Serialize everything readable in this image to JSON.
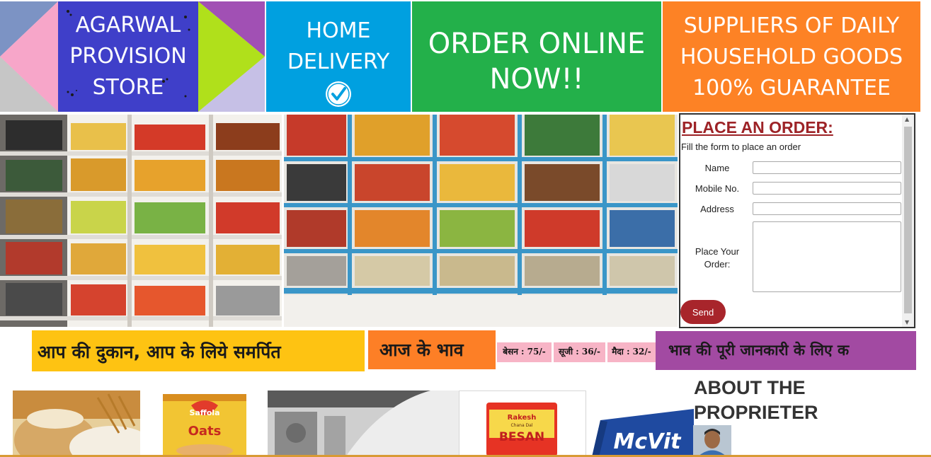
{
  "header": {
    "logo_lines": [
      "AGARWAL",
      "PROVISION",
      "STORE"
    ],
    "delivery_lines": [
      "HOME",
      "DELIVERY"
    ],
    "order_online_lines": [
      "ORDER ONLINE",
      "NOW!!"
    ],
    "supplier_lines": [
      "SUPPLIERS OF DAILY",
      "HOUSEHOLD GOODS",
      "100% GUARANTEE"
    ]
  },
  "order_form": {
    "title": "PLACE AN ORDER:",
    "subtitle": "Fill the form to place an order",
    "name_label": "Name",
    "mobile_label": "Mobile No.",
    "address_label": "Address",
    "order_label_lines": [
      "Place Your",
      "Order:"
    ],
    "send_label": "Send"
  },
  "strip": {
    "tagline": "आप की दुकान, आप के लिये समर्पित",
    "rates_heading": "आज के भाव",
    "prices": [
      "बेसन : 75/-",
      "सूजी : 36/-",
      "मैदा : 32/-"
    ],
    "marquee": "भाव की पूरी जानकारी के लिए क"
  },
  "products": {
    "oats_brand": "Saffola",
    "oats_name": "Oats",
    "besan_brand": "Rakesh",
    "besan_subtitle": "Chana Dal",
    "besan_name": "BESAN",
    "biscuit_name": "McVit"
  },
  "about": {
    "heading_lines": [
      "ABOUT THE",
      "PROPRIETER"
    ]
  },
  "colors": {
    "delivery_blue": "#00a0e0",
    "order_green": "#23b04a",
    "supplier_orange": "#fd8225",
    "logo_purple": "#3f3fc9",
    "form_title_red": "#9d2327",
    "send_button": "#a8252b",
    "tagline_yellow": "#fec312",
    "rates_orange": "#fd7f26",
    "price_pink": "#f7b4c6",
    "marquee_purple": "#a24aa2"
  },
  "icons": {
    "delivery": "check-circle-icon",
    "scroll_up": "triangle-up-icon",
    "scroll_down": "triangle-down-icon"
  }
}
